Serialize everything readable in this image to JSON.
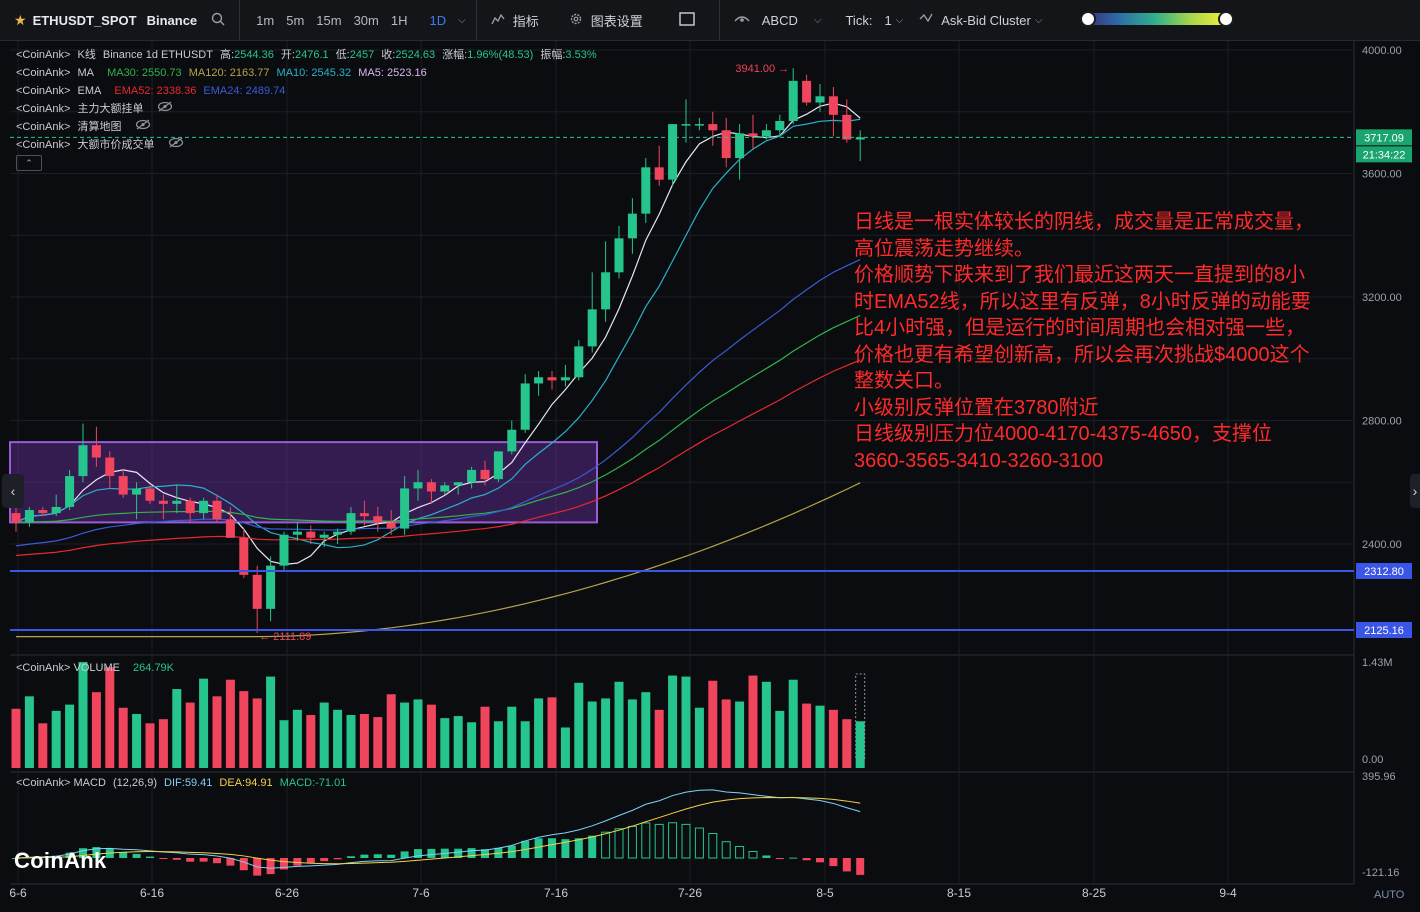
{
  "toolbar": {
    "symbol": "ETHUSDT_SPOT",
    "exchange": "Binance",
    "timeframes": [
      "1m",
      "5m",
      "15m",
      "30m",
      "1H",
      "1D"
    ],
    "active_timeframe": "1D",
    "indicators_label": "指标",
    "chart_settings_label": "图表设置",
    "abcd_label": "ABCD",
    "tick_label": "Tick:",
    "tick_value": "1",
    "cluster_label": "Ask-Bid Cluster"
  },
  "legends": {
    "kline": {
      "prefix": "<CoinAnk>",
      "name": "K线",
      "info": "Binance 1d ETHUSDT",
      "high_label": "高:",
      "high": "2544.36",
      "open_label": "开:",
      "open": "2476.1",
      "low_label": "低:",
      "low": "2457",
      "close_label": "收:",
      "close": "2524.63",
      "change_label": "涨幅:",
      "change": "1.96%(48.53)",
      "amp_label": "振幅:",
      "amp": "3.53%"
    },
    "ma": {
      "prefix": "<CoinAnk>",
      "name": "MA",
      "ma30": "MA30: 2550.73",
      "ma120": "MA120: 2163.77",
      "ma10": "MA10: 2545.32",
      "ma5": "MA5: 2523.16"
    },
    "ema": {
      "prefix": "<CoinAnk>",
      "name": "EMA",
      "ema52": "EMA52: 2338.36",
      "ema24": "EMA24: 2489.74"
    },
    "big_orders": {
      "prefix": "<CoinAnk>",
      "name": "主力大额挂单"
    },
    "liq_map": {
      "prefix": "<CoinAnk>",
      "name": "清算地图"
    },
    "big_trades": {
      "prefix": "<CoinAnk>",
      "name": "大额市价成交单"
    },
    "volume": {
      "prefix": "<CoinAnk>",
      "name": "VOLUME",
      "value": "264.79K"
    },
    "macd": {
      "prefix": "<CoinAnk>",
      "name": "MACD",
      "params": "(12,26,9)",
      "dif": "DIF:59.41",
      "dea": "DEA:94.91",
      "macd": "MACD:-71.01"
    }
  },
  "annotation": [
    "日线是一根实体较长的阴线，成交量是正常成交量，",
    "高位震荡走势继续。",
    "价格顺势下跌来到了我们最近这两天一直提到的8小",
    "时EMA52线，所以这里有反弹，8小时反弹的动能要",
    "比4小时强，但是运行的时间周期也会相对强一些，",
    "价格也更有希望创新高，所以会再次挑战$4000这个",
    "整数关口。",
    "小级别反弹位置在3780附近",
    "日线级别压力位4000-4170-4375-4650，支撑位",
    "3660-3565-3410-3260-3100"
  ],
  "logo": "CoinAnk",
  "auto_label": "AUTO",
  "colors": {
    "up": "#26c58d",
    "down": "#f0455c",
    "ma5": "#e6e6f5",
    "ma10": "#2ab0c9",
    "ma30": "#2fb34a",
    "ma120": "#b8a24a",
    "ema52": "#e8282f",
    "ema24": "#3a5bd8",
    "hline": "#3a56e6",
    "box": "#9a5bd6",
    "annotation": "#ff2a2a"
  },
  "chart_data": {
    "type": "candlestick",
    "x_ticks": [
      "6-6",
      "6-16",
      "6-26",
      "7-6",
      "7-16",
      "7-26",
      "8-5",
      "8-15",
      "8-25",
      "9-4"
    ],
    "y_ticks": [
      "4000.00",
      "3600.00",
      "3200.00",
      "2800.00",
      "2400.00"
    ],
    "last_price": "3717.09",
    "countdown": "21:34:22",
    "max_label": "3941.00",
    "min_label": "2111.89",
    "horizontal_lines": [
      {
        "value": 2312.8,
        "label": "2312.80"
      },
      {
        "value": 2125.16,
        "label": "2125.16"
      }
    ],
    "range_box": {
      "from_index": 0,
      "to_index": 45,
      "low": 2470,
      "high": 2730
    },
    "candles": [
      [
        2500,
        2520,
        2440,
        2470
      ],
      [
        2470,
        2520,
        2455,
        2510
      ],
      [
        2510,
        2520,
        2490,
        2500
      ],
      [
        2500,
        2560,
        2490,
        2520
      ],
      [
        2520,
        2640,
        2510,
        2620
      ],
      [
        2620,
        2790,
        2600,
        2720
      ],
      [
        2720,
        2780,
        2650,
        2680
      ],
      [
        2680,
        2700,
        2580,
        2620
      ],
      [
        2620,
        2640,
        2550,
        2560
      ],
      [
        2560,
        2600,
        2480,
        2580
      ],
      [
        2580,
        2590,
        2530,
        2540
      ],
      [
        2540,
        2560,
        2480,
        2530
      ],
      [
        2530,
        2590,
        2500,
        2540
      ],
      [
        2540,
        2550,
        2470,
        2500
      ],
      [
        2500,
        2550,
        2480,
        2540
      ],
      [
        2540,
        2560,
        2470,
        2480
      ],
      [
        2480,
        2520,
        2440,
        2420
      ],
      [
        2420,
        2450,
        2290,
        2300
      ],
      [
        2300,
        2330,
        2111.89,
        2190
      ],
      [
        2190,
        2360,
        2150,
        2330
      ],
      [
        2330,
        2440,
        2310,
        2430
      ],
      [
        2430,
        2470,
        2410,
        2440
      ],
      [
        2440,
        2460,
        2400,
        2420
      ],
      [
        2420,
        2440,
        2390,
        2430
      ],
      [
        2430,
        2450,
        2400,
        2440
      ],
      [
        2440,
        2520,
        2430,
        2500
      ],
      [
        2500,
        2540,
        2460,
        2490
      ],
      [
        2490,
        2520,
        2440,
        2470
      ],
      [
        2470,
        2510,
        2430,
        2450
      ],
      [
        2450,
        2620,
        2430,
        2580
      ],
      [
        2580,
        2640,
        2540,
        2600
      ],
      [
        2600,
        2610,
        2530,
        2570
      ],
      [
        2570,
        2600,
        2560,
        2590
      ],
      [
        2590,
        2600,
        2560,
        2600
      ],
      [
        2600,
        2650,
        2580,
        2640
      ],
      [
        2640,
        2670,
        2590,
        2610
      ],
      [
        2610,
        2700,
        2600,
        2700
      ],
      [
        2700,
        2800,
        2690,
        2770
      ],
      [
        2770,
        2950,
        2760,
        2920
      ],
      [
        2920,
        2960,
        2880,
        2940
      ],
      [
        2940,
        2960,
        2900,
        2930
      ],
      [
        2930,
        2980,
        2910,
        2940
      ],
      [
        2940,
        3060,
        2930,
        3040
      ],
      [
        3040,
        3280,
        3020,
        3160
      ],
      [
        3160,
        3380,
        3120,
        3280
      ],
      [
        3280,
        3430,
        3260,
        3390
      ],
      [
        3390,
        3520,
        3340,
        3470
      ],
      [
        3470,
        3650,
        3440,
        3620
      ],
      [
        3620,
        3690,
        3560,
        3580
      ],
      [
        3580,
        3760,
        3560,
        3760
      ],
      [
        3760,
        3840,
        3700,
        3760
      ],
      [
        3760,
        3780,
        3740,
        3760
      ],
      [
        3760,
        3800,
        3690,
        3740
      ],
      [
        3740,
        3780,
        3620,
        3650
      ],
      [
        3650,
        3760,
        3580,
        3730
      ],
      [
        3730,
        3790,
        3680,
        3720
      ],
      [
        3720,
        3760,
        3710,
        3740
      ],
      [
        3740,
        3790,
        3720,
        3770
      ],
      [
        3770,
        3941,
        3760,
        3900
      ],
      [
        3900,
        3920,
        3820,
        3830
      ],
      [
        3830,
        3890,
        3800,
        3850
      ],
      [
        3850,
        3880,
        3720,
        3790
      ],
      [
        3790,
        3840,
        3700,
        3710
      ],
      [
        3710,
        3740,
        3640,
        3717.09
      ]
    ],
    "volume_ylim": [
      0,
      1430000
    ],
    "volume_labels": [
      "1.43M",
      "0.00"
    ],
    "volume": [
      0.57,
      0.69,
      0.43,
      0.55,
      0.61,
      1.02,
      0.73,
      0.97,
      0.58,
      0.52,
      0.43,
      0.47,
      0.76,
      0.63,
      0.86,
      0.69,
      0.85,
      0.74,
      0.67,
      0.88,
      0.46,
      0.56,
      0.51,
      0.63,
      0.56,
      0.51,
      0.52,
      0.49,
      0.71,
      0.63,
      0.66,
      0.61,
      0.48,
      0.5,
      0.44,
      0.59,
      0.45,
      0.59,
      0.45,
      0.67,
      0.68,
      0.39,
      0.82,
      0.64,
      0.67,
      0.83,
      0.66,
      0.73,
      0.56,
      0.89,
      0.88,
      0.58,
      0.84,
      0.66,
      0.64,
      0.89,
      0.83,
      0.55,
      0.85,
      0.62,
      0.6,
      0.56,
      0.47,
      0.45
    ],
    "macd_labels": [
      "395.96",
      "-121.16"
    ]
  }
}
